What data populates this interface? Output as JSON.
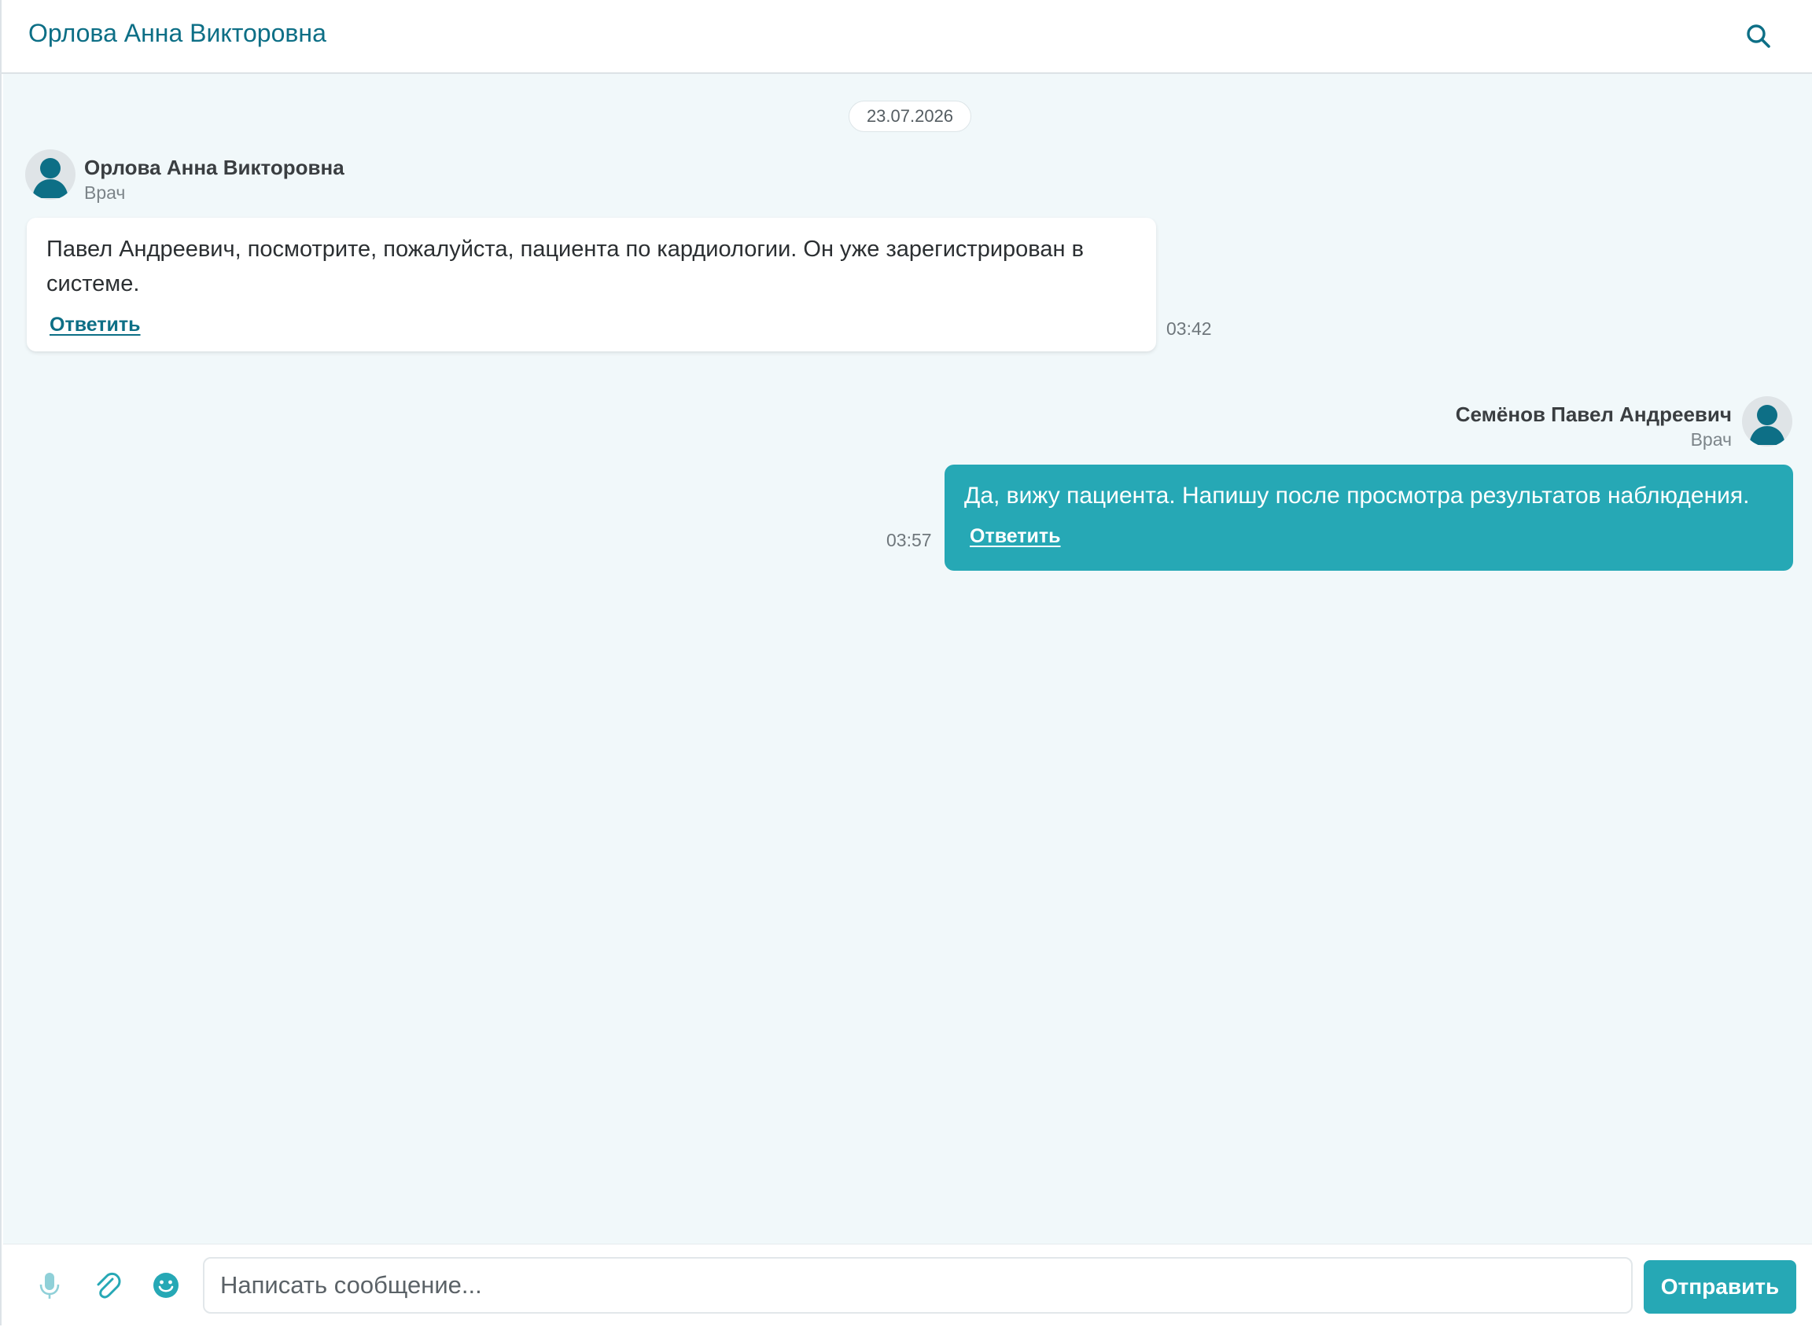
{
  "header": {
    "title": "Орлова Анна Викторовна",
    "search_icon": "search-icon"
  },
  "chat": {
    "date_separator": "23.07.2026",
    "messages": [
      {
        "direction": "incoming",
        "sender_name": "Орлова Анна Викторовна",
        "sender_role": "Врач",
        "text": "Павел Андреевич, посмотрите, пожалуйста, пациента по кардиологии. Он уже зарегистрирован в системе.",
        "reply_label": "Ответить",
        "time": "03:42",
        "avatar_icon": "user-avatar-icon"
      },
      {
        "direction": "outgoing",
        "sender_name": "Семёнов Павел Андреевич",
        "sender_role": "Врач",
        "text": "Да, вижу пациента. Напишу после просмотра результатов наблюдения.",
        "reply_label": "Ответить",
        "time": "03:57",
        "avatar_icon": "user-avatar-icon"
      }
    ]
  },
  "composer": {
    "placeholder": "Написать сообщение...",
    "value": "",
    "send_label": "Отправить",
    "icons": [
      "microphone-icon",
      "paperclip-icon",
      "emoji-icon"
    ]
  },
  "colors": {
    "accent": "#26a8b5",
    "title": "#0d6f86",
    "chat_background": "#f1f8fa",
    "avatar_figure": "#0d6f86"
  }
}
